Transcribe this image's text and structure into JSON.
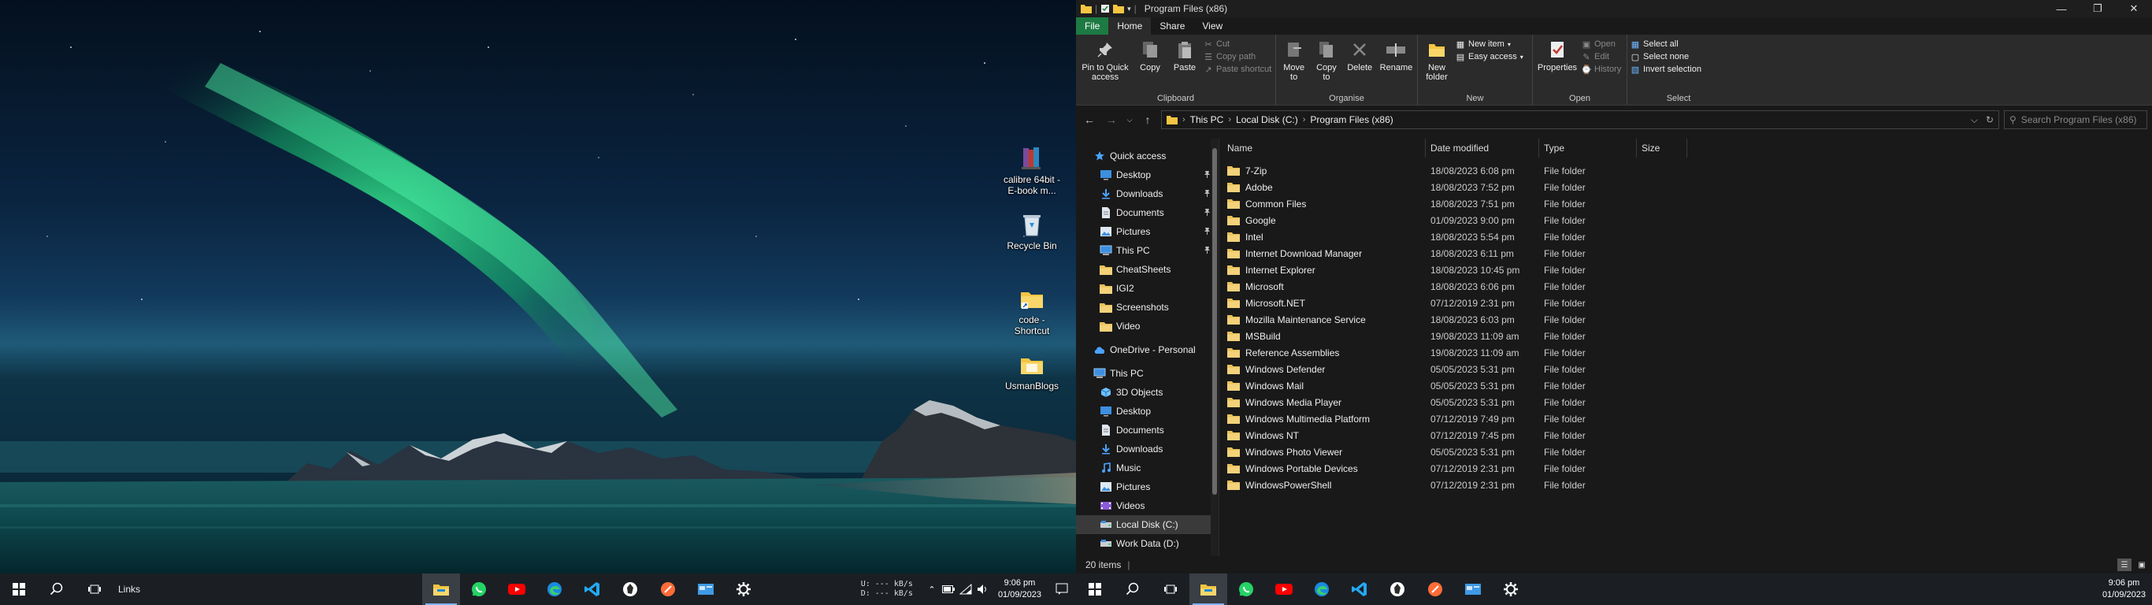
{
  "desktop": {
    "icons": [
      {
        "label": "calibre 64bit - E-book m...",
        "icon": "calibre-icon"
      },
      {
        "label": "Recycle Bin",
        "icon": "recycle-bin-icon"
      },
      {
        "label": "code - Shortcut",
        "icon": "folder-shortcut-icon"
      },
      {
        "label": "UsmanBlogs",
        "icon": "folder-icon"
      }
    ]
  },
  "taskbar1": {
    "links_label": "Links",
    "apps": [
      "file-explorer-icon",
      "whatsapp-icon",
      "youtube-icon",
      "edge-icon",
      "vscode-icon",
      "obsidian-icon",
      "postman-icon",
      "app-window-icon",
      "settings-icon"
    ],
    "net_up_label": "U:",
    "net_down_label": "D:",
    "net_up": "--- kB/s",
    "net_down": "--- kB/s",
    "time": "9:06 pm",
    "date": "01/09/2023"
  },
  "taskbar2": {
    "time": "9:06 pm",
    "date": "01/09/2023"
  },
  "explorer": {
    "title": "Program Files (x86)",
    "tabs": [
      "File",
      "Home",
      "Share",
      "View"
    ],
    "ribbon": {
      "clipboard": {
        "name": "Clipboard",
        "pin": "Pin to Quick access",
        "copy": "Copy",
        "paste": "Paste",
        "cut": "Cut",
        "copy_path": "Copy path",
        "paste_shortcut": "Paste shortcut"
      },
      "organise": {
        "name": "Organise",
        "move_to": "Move to",
        "copy_to": "Copy to",
        "delete": "Delete",
        "rename": "Rename"
      },
      "new": {
        "name": "New",
        "new_folder": "New folder",
        "new_item": "New item",
        "easy_access": "Easy access"
      },
      "open": {
        "name": "Open",
        "properties": "Properties",
        "open": "Open",
        "edit": "Edit",
        "history": "History"
      },
      "select": {
        "name": "Select",
        "select_all": "Select all",
        "select_none": "Select none",
        "invert": "Invert selection"
      }
    },
    "address": {
      "crumbs": [
        "This PC",
        "Local Disk (C:)",
        "Program Files (x86)"
      ],
      "search_placeholder": "Search Program Files (x86)"
    },
    "nav": [
      {
        "label": "Quick access",
        "icon": "star-icon",
        "level": 0,
        "pinned": false
      },
      {
        "label": "Desktop",
        "icon": "desktop-icon",
        "level": 1,
        "pinned": true
      },
      {
        "label": "Downloads",
        "icon": "download-icon",
        "level": 1,
        "pinned": true
      },
      {
        "label": "Documents",
        "icon": "documents-icon",
        "level": 1,
        "pinned": true
      },
      {
        "label": "Pictures",
        "icon": "pictures-icon",
        "level": 1,
        "pinned": true
      },
      {
        "label": "This PC",
        "icon": "pc-icon",
        "level": 1,
        "pinned": true
      },
      {
        "label": "CheatSheets",
        "icon": "folder-icon",
        "level": 1,
        "pinned": false
      },
      {
        "label": "IGI2",
        "icon": "folder-icon",
        "level": 1,
        "pinned": false
      },
      {
        "label": "Screenshots",
        "icon": "folder-icon",
        "level": 1,
        "pinned": false
      },
      {
        "label": "Video",
        "icon": "folder-icon",
        "level": 1,
        "pinned": false
      },
      {
        "label": "OneDrive - Personal",
        "icon": "cloud-icon",
        "level": 0,
        "pinned": false
      },
      {
        "label": "This PC",
        "icon": "pc-icon",
        "level": 0,
        "pinned": false
      },
      {
        "label": "3D Objects",
        "icon": "cube-icon",
        "level": 1,
        "pinned": false
      },
      {
        "label": "Desktop",
        "icon": "desktop-icon",
        "level": 1,
        "pinned": false
      },
      {
        "label": "Documents",
        "icon": "documents-icon",
        "level": 1,
        "pinned": false
      },
      {
        "label": "Downloads",
        "icon": "download-icon",
        "level": 1,
        "pinned": false
      },
      {
        "label": "Music",
        "icon": "music-icon",
        "level": 1,
        "pinned": false
      },
      {
        "label": "Pictures",
        "icon": "pictures-icon",
        "level": 1,
        "pinned": false
      },
      {
        "label": "Videos",
        "icon": "video-icon",
        "level": 1,
        "pinned": false
      },
      {
        "label": "Local Disk (C:)",
        "icon": "drive-icon",
        "level": 1,
        "pinned": false,
        "selected": true
      },
      {
        "label": "Work Data (D:)",
        "icon": "drive-icon",
        "level": 1,
        "pinned": false
      }
    ],
    "columns": [
      "Name",
      "Date modified",
      "Type",
      "Size"
    ],
    "files": [
      {
        "name": "7-Zip",
        "date": "18/08/2023 6:08 pm",
        "type": "File folder"
      },
      {
        "name": "Adobe",
        "date": "18/08/2023 7:52 pm",
        "type": "File folder"
      },
      {
        "name": "Common Files",
        "date": "18/08/2023 7:51 pm",
        "type": "File folder"
      },
      {
        "name": "Google",
        "date": "01/09/2023 9:00 pm",
        "type": "File folder"
      },
      {
        "name": "Intel",
        "date": "18/08/2023 5:54 pm",
        "type": "File folder"
      },
      {
        "name": "Internet Download Manager",
        "date": "18/08/2023 6:11 pm",
        "type": "File folder"
      },
      {
        "name": "Internet Explorer",
        "date": "18/08/2023 10:45 pm",
        "type": "File folder"
      },
      {
        "name": "Microsoft",
        "date": "18/08/2023 6:06 pm",
        "type": "File folder"
      },
      {
        "name": "Microsoft.NET",
        "date": "07/12/2019 2:31 pm",
        "type": "File folder"
      },
      {
        "name": "Mozilla Maintenance Service",
        "date": "18/08/2023 6:03 pm",
        "type": "File folder"
      },
      {
        "name": "MSBuild",
        "date": "19/08/2023 11:09 am",
        "type": "File folder"
      },
      {
        "name": "Reference Assemblies",
        "date": "19/08/2023 11:09 am",
        "type": "File folder"
      },
      {
        "name": "Windows Defender",
        "date": "05/05/2023 5:31 pm",
        "type": "File folder"
      },
      {
        "name": "Windows Mail",
        "date": "05/05/2023 5:31 pm",
        "type": "File folder"
      },
      {
        "name": "Windows Media Player",
        "date": "05/05/2023 5:31 pm",
        "type": "File folder"
      },
      {
        "name": "Windows Multimedia Platform",
        "date": "07/12/2019 7:49 pm",
        "type": "File folder"
      },
      {
        "name": "Windows NT",
        "date": "07/12/2019 7:45 pm",
        "type": "File folder"
      },
      {
        "name": "Windows Photo Viewer",
        "date": "05/05/2023 5:31 pm",
        "type": "File folder"
      },
      {
        "name": "Windows Portable Devices",
        "date": "07/12/2019 2:31 pm",
        "type": "File folder"
      },
      {
        "name": "WindowsPowerShell",
        "date": "07/12/2019 2:31 pm",
        "type": "File folder"
      }
    ],
    "status": "20 items",
    "colors": {
      "file_tab": "#1d7a43",
      "folder": "#e8c15a",
      "accent": "#7fb3ff"
    }
  }
}
